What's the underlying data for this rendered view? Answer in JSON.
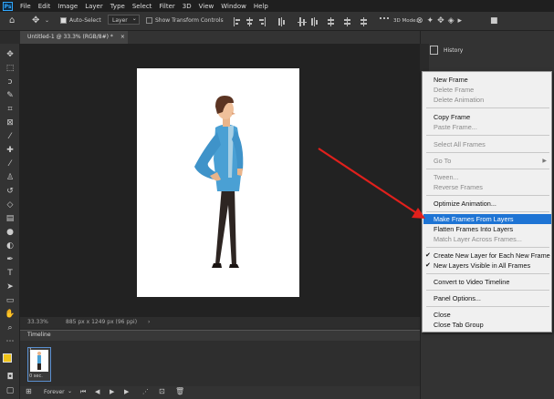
{
  "menubar": {
    "logo": "Ps",
    "items": [
      "File",
      "Edit",
      "Image",
      "Layer",
      "Type",
      "Select",
      "Filter",
      "3D",
      "View",
      "Window",
      "Help"
    ]
  },
  "options": {
    "auto_select_label": "Auto-Select",
    "layer_select": "Layer",
    "show_transform_label": "Show Transform Controls",
    "mode_3d": "3D Mode:"
  },
  "document": {
    "tab_title": "Untitled-1 @ 33.3% (RGB/8#) *",
    "zoom": "33.33%",
    "doc_info": "885 px x 1249 px (96 ppi)"
  },
  "timeline": {
    "title": "Timeline",
    "frame_number": "1",
    "frame_delay": "0 sec.",
    "loop": "Forever"
  },
  "panel": {
    "history_label": "History"
  },
  "flyout": {
    "items": [
      {
        "label": "New Frame",
        "disabled": false
      },
      {
        "label": "Delete Frame",
        "disabled": true
      },
      {
        "label": "Delete Animation",
        "disabled": true
      },
      {
        "label": "Copy Frame",
        "disabled": false
      },
      {
        "label": "Paste Frame...",
        "disabled": true
      },
      {
        "label": "Select All Frames",
        "disabled": true
      },
      {
        "label": "Go To",
        "disabled": true,
        "submenu": true
      },
      {
        "label": "Tween...",
        "disabled": true
      },
      {
        "label": "Reverse Frames",
        "disabled": true
      },
      {
        "label": "Optimize Animation...",
        "disabled": false
      },
      {
        "label": "Make Frames From Layers",
        "disabled": false,
        "highlighted": true
      },
      {
        "label": "Flatten Frames Into Layers",
        "disabled": false
      },
      {
        "label": "Match Layer Across Frames...",
        "disabled": true
      },
      {
        "label": "Create New Layer for Each New Frame",
        "disabled": false,
        "checked": true
      },
      {
        "label": "New Layers Visible in All Frames",
        "disabled": false,
        "checked": true
      },
      {
        "label": "Convert to Video Timeline",
        "disabled": false
      },
      {
        "label": "Panel Options...",
        "disabled": false
      },
      {
        "label": "Close",
        "disabled": false
      },
      {
        "label": "Close Tab Group",
        "disabled": false
      }
    ]
  },
  "colors": {
    "accent": "#1e74d4",
    "annotation_arrow": "#e0201c"
  }
}
